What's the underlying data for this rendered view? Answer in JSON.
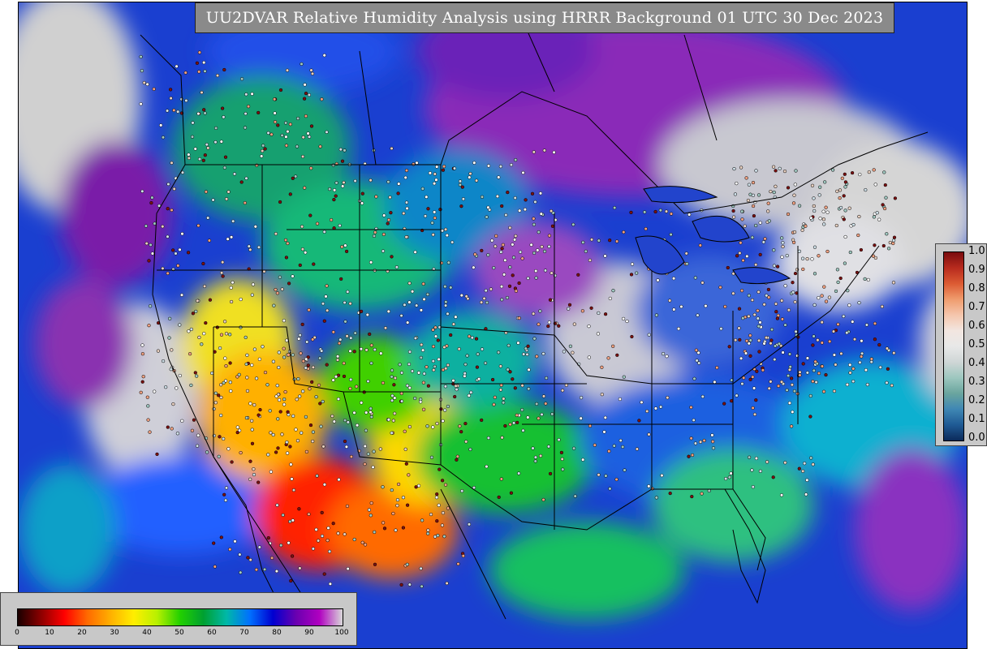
{
  "title": "UU2DVAR Relative Humidity Analysis using HRRR Background 01 UTC 30 Dec 2023",
  "colors": {
    "ocean": "#1a3fd0",
    "title_bg": "#8a8a8a",
    "legend_bg": "#c8c8c8",
    "boundary": "#000000"
  },
  "legend_right": {
    "ticks": [
      "1.0",
      "0.9",
      "0.8",
      "0.7",
      "0.6",
      "0.5",
      "0.4",
      "0.3",
      "0.2",
      "0.1",
      "0.0"
    ],
    "gradient": [
      "#0b2a5a",
      "#1f5a94",
      "#3f87b4",
      "#6aa59e",
      "#9dc7bf",
      "#cfd6d6",
      "#e8e8e8",
      "#f2e6e0",
      "#f5c6ad",
      "#ef9c6e",
      "#dc5b33",
      "#b82b1e",
      "#7a0c0e"
    ]
  },
  "legend_bottom": {
    "ticks": [
      "0",
      "10",
      "20",
      "30",
      "40",
      "50",
      "60",
      "70",
      "80",
      "90",
      "100"
    ],
    "gradient": [
      "#1a0000",
      "#8c0000",
      "#ff0000",
      "#ff6a00",
      "#ffb000",
      "#ffee00",
      "#b8f000",
      "#22d000",
      "#00a030",
      "#00b8a8",
      "#0070ff",
      "#0000d0",
      "#6a00b0",
      "#b000c0",
      "#d8d8d8"
    ]
  }
}
